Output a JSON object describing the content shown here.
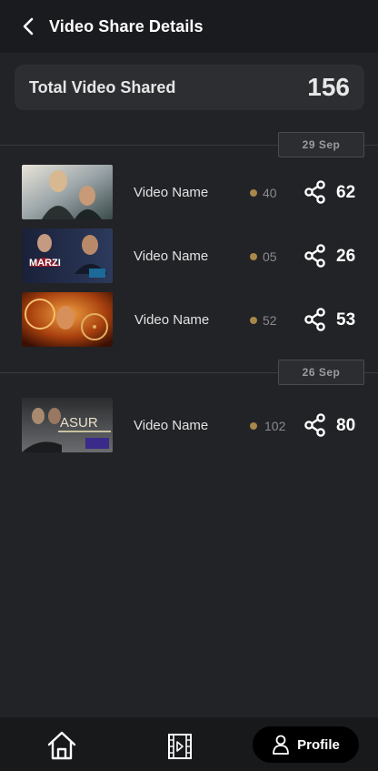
{
  "header": {
    "title": "Video Share Details"
  },
  "summary": {
    "label": "Total Video Shared",
    "value": "156"
  },
  "groups": [
    {
      "date": "29  Sep",
      "items": [
        {
          "name": "Video Name",
          "views": "40",
          "shares": "62",
          "thumb_colors": [
            "#4a5a6a",
            "#c8b89a"
          ]
        },
        {
          "name": "Video Name",
          "views": "05",
          "shares": "26",
          "thumb_colors": [
            "#1f2a44",
            "#9a2030"
          ],
          "thumb_text": "MARZI"
        },
        {
          "name": "Video Name",
          "views": "52",
          "shares": "53",
          "thumb_colors": [
            "#6a2a0a",
            "#e08a2a"
          ]
        }
      ]
    },
    {
      "date": "26  Sep",
      "items": [
        {
          "name": "Video Name",
          "views": "102",
          "shares": "80",
          "thumb_colors": [
            "#3a3a3a",
            "#d8d0b0"
          ],
          "thumb_text": "ASUR"
        }
      ]
    }
  ],
  "nav": {
    "home_icon": "home-icon",
    "video_icon": "video-icon",
    "profile_label": "Profile"
  },
  "colors": {
    "background": "#222326",
    "header": "#1a1b1e",
    "card": "#2d2e32",
    "dot": "#a8874a",
    "nav": "#18191b"
  }
}
